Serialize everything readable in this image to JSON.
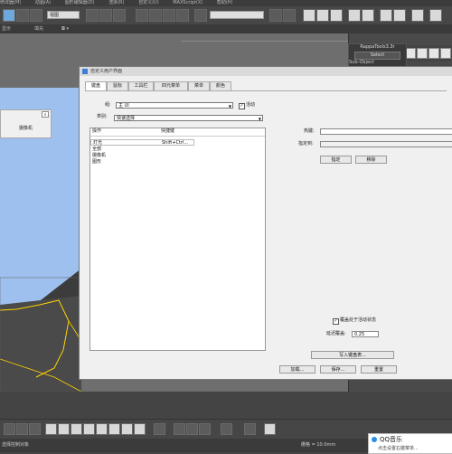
{
  "menubar": [
    "修改器(M)",
    "动画(A)",
    "图形编辑器(D)",
    "渲染(R)",
    "自定义(U)",
    "MAXScript(X)",
    "帮助(H)"
  ],
  "toolbar": {
    "selection_dropdown": "视图",
    "named_set_dropdown": ""
  },
  "subbar": {
    "label1": "显示",
    "label2": "填充"
  },
  "right_panel": {
    "tool_title": "RappaTools3.3r",
    "tool_button": "Select",
    "subtitle": "Sub-Object"
  },
  "float_dialog": {
    "close": "×",
    "item": "摄像机"
  },
  "dialog": {
    "title": "自定义用户界面",
    "tabs": [
      "键盘",
      "鼠标",
      "工具栏",
      "四元菜单",
      "菜单",
      "颜色"
    ],
    "group_label": "组:",
    "group_value": "主 UI",
    "active_label": "活动",
    "category_label": "类别:",
    "category_value": "快速选择",
    "list_headers": {
      "action": "操作",
      "shortcut": "快捷键"
    },
    "list_rows": [
      {
        "action": "灯光",
        "shortcut": "Shift+Ctrl..."
      },
      {
        "action": "全部",
        "shortcut": ""
      },
      {
        "action": "摄像机",
        "shortcut": ""
      },
      {
        "action": "图形",
        "shortcut": ""
      }
    ],
    "hotkey_label": "热键:",
    "assigned_label": "指定到:",
    "assign_button": "指定",
    "remove_button": "移除",
    "override_label": "覆盖处于活动状态",
    "delay_label": "延迟覆盖:",
    "delay_value": "0.25",
    "write_button": "写入键盘表...",
    "load_button": "加载...",
    "save_button": "保存...",
    "reset_button": "重置"
  },
  "status": {
    "left_text": "选择控制对象",
    "grid_text": "栅格 = 10.0mm"
  },
  "notification": {
    "title": "QQ音乐",
    "text": "点击设置右键菜单..."
  },
  "colors": {
    "viewport_blue": "#9ec0ee",
    "selection_yellow": "#ffd200",
    "accent_blue": "#3a7fd5"
  }
}
